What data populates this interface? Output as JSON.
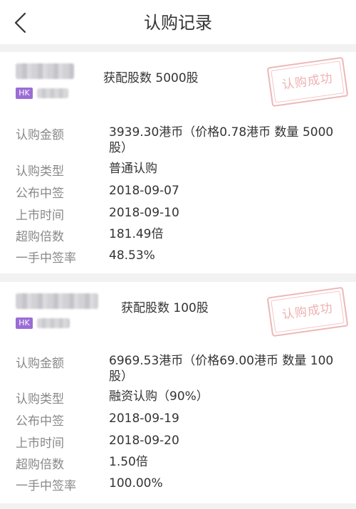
{
  "header": {
    "title": "认购记录"
  },
  "records": [
    {
      "allotted": "获配股数 5000股",
      "tag": "HK",
      "stamp": "认购成功",
      "fields": [
        {
          "label": "认购金额",
          "value": "3939.30港币（价格0.78港币 数量 5000股）"
        },
        {
          "label": "认购类型",
          "value": "普通认购"
        },
        {
          "label": "公布中签",
          "value": "2018-09-07"
        },
        {
          "label": "上市时间",
          "value": "2018-09-10"
        },
        {
          "label": "超购倍数",
          "value": "181.49倍"
        },
        {
          "label": "一手中签率",
          "value": "48.53%"
        }
      ]
    },
    {
      "allotted": "获配股数 100股",
      "tag": "HK",
      "stamp": "认购成功",
      "fields": [
        {
          "label": "认购金额",
          "value": "6969.53港币（价格69.00港币 数量 100股）"
        },
        {
          "label": "认购类型",
          "value": "融资认购（90%）"
        },
        {
          "label": "公布中签",
          "value": "2018-09-19"
        },
        {
          "label": "上市时间",
          "value": "2018-09-20"
        },
        {
          "label": "超购倍数",
          "value": "1.50倍"
        },
        {
          "label": "一手中签率",
          "value": "100.00%"
        }
      ]
    }
  ],
  "icons": {
    "back": "chevron-left-icon"
  },
  "colors": {
    "tag": "#9b6cd6",
    "stamp": "#efb1b1",
    "label": "#888888",
    "value": "#333333"
  }
}
